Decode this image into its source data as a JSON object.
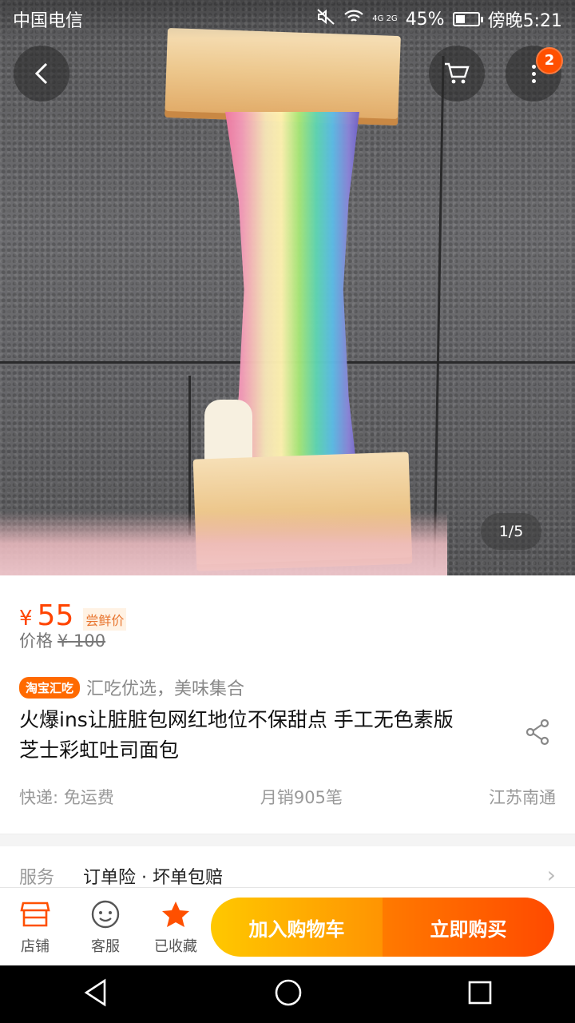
{
  "status_bar": {
    "carrier": "中国电信",
    "network": "4G 2G",
    "battery": "45%",
    "battery_level": 0.45,
    "time": "傍晚5:21"
  },
  "header": {
    "cart_badge": "2"
  },
  "gallery": {
    "indicator": "1/5"
  },
  "product": {
    "currency": "¥",
    "price": "55",
    "price_tag": "尝鲜价",
    "original_label": "价格",
    "original_price": "¥ 100",
    "promo_tag": "淘宝汇吃",
    "promo_text": "汇吃优选，美味集合",
    "title": "火爆ins让脏脏包网红地位不保甜点 手工无色素版芝士彩虹吐司面包",
    "shipping": "快递: 免运费",
    "monthly_sales": "月销905笔",
    "location": "江苏南通"
  },
  "service": {
    "label": "服务",
    "value": "订单险 · 坏单包赔"
  },
  "bottom_bar": {
    "shop": "店铺",
    "support": "客服",
    "favorited": "已收藏",
    "add_to_cart": "加入购物车",
    "buy_now": "立即购买"
  },
  "colors": {
    "accent": "#ff5000",
    "price": "#ff4400",
    "cart_button": "#ffb000",
    "buy_button": "#ff5a00"
  }
}
